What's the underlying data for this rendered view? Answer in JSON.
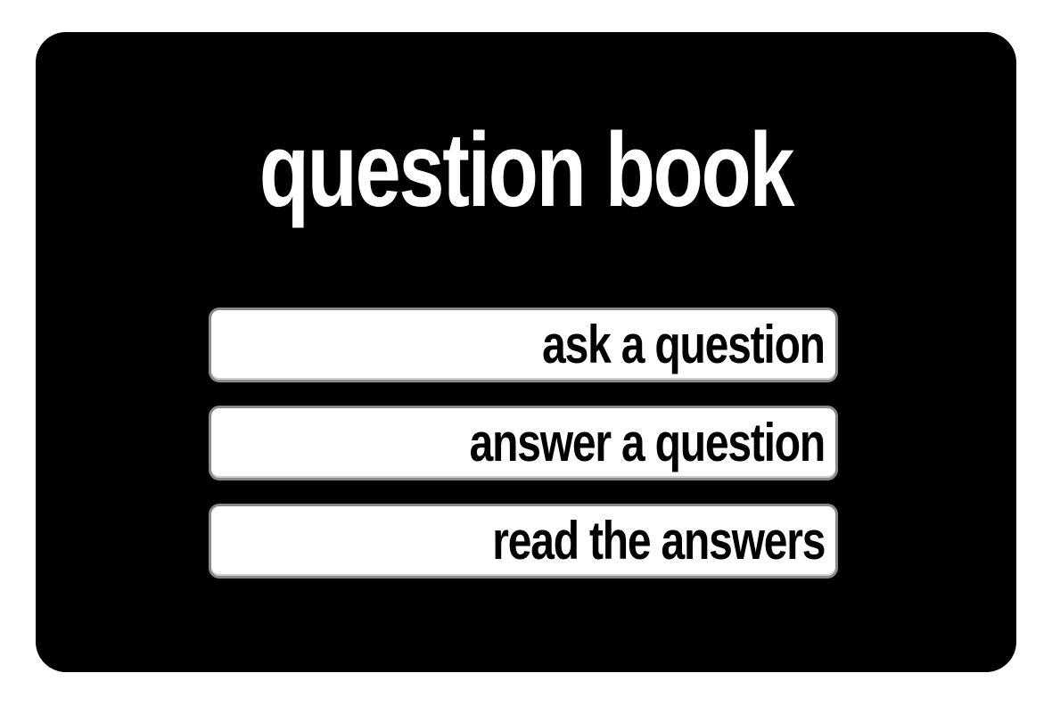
{
  "app": {
    "title": "question book"
  },
  "menu": {
    "items": [
      {
        "label": "ask a question"
      },
      {
        "label": "answer a question"
      },
      {
        "label": "read the answers"
      }
    ]
  },
  "colors": {
    "background": "#ffffff",
    "card": "#000000",
    "title_text": "#ffffff",
    "button_fill": "#ffffff",
    "button_border": "#8a8a8a",
    "button_text": "#000000"
  }
}
